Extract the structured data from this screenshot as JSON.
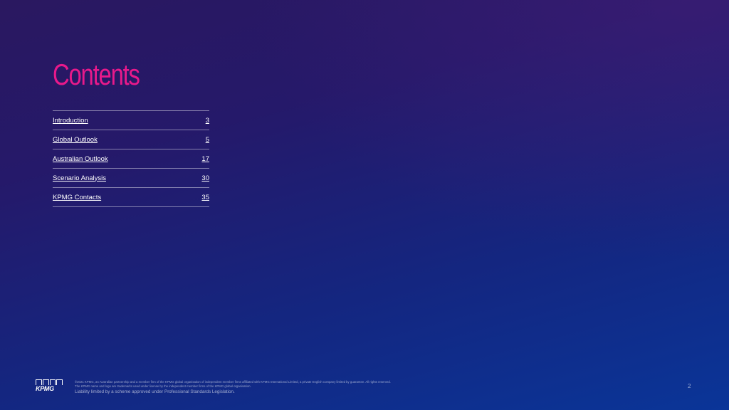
{
  "page": {
    "title": "Contents",
    "page_number": "2"
  },
  "toc": [
    {
      "label": "Introduction",
      "page": "3"
    },
    {
      "label": "Global Outlook",
      "page": "5"
    },
    {
      "label": "Australian Outlook",
      "page": "17"
    },
    {
      "label": "Scenario Analysis",
      "page": "30"
    },
    {
      "label": "KPMG Contacts",
      "page": "35"
    }
  ],
  "footer": {
    "logo_text": "KPMG",
    "line1": "©2021 KPMG, an Australian partnership and a member firm of the KPMG global organisation of independent member firms affiliated with KPMG International Limited, a private English company limited by guarantee. All rights reserved.",
    "line2": "The KPMG name and logo are trademarks used under license by the independent member firms of the KPMG global organisation.",
    "liability": "Liability limited by a scheme approved under Professional Standards Legislation."
  },
  "colors": {
    "title": "#e8198b",
    "background_top": "#2a1860",
    "background_bottom": "#0a3598"
  }
}
